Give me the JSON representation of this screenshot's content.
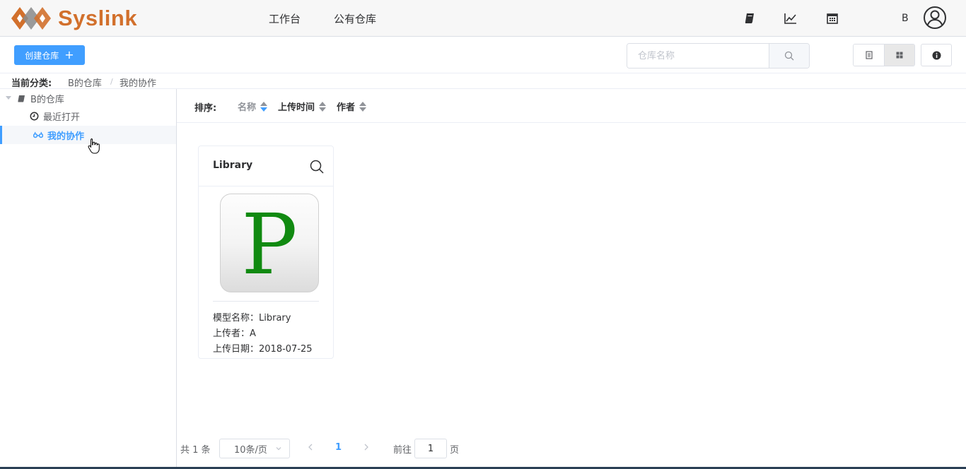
{
  "header": {
    "brand": "Syslink",
    "nav": [
      "工作台",
      "公有仓库"
    ],
    "user_initial": "B",
    "icons": [
      "book-icon",
      "line-chart-icon",
      "calendar-icon",
      "user-avatar-icon"
    ]
  },
  "toolbar": {
    "create_label": "创建仓库",
    "create_icon": "plus-icon",
    "search_placeholder": "仓库名称",
    "view_modes": [
      "list-view-icon",
      "grid-view-icon"
    ],
    "active_view": "grid",
    "info_icon": "info-icon"
  },
  "breadcrumb": {
    "label": "当前分类:",
    "items": [
      "B的仓库",
      "我的协作"
    ],
    "separator": "/"
  },
  "sidebar": {
    "root": "B的仓库",
    "items": [
      {
        "label": "最近打开",
        "icon": "clock-icon"
      },
      {
        "label": "我的协作",
        "icon": "collaboration-icon",
        "active": true
      }
    ]
  },
  "sort": {
    "label": "排序:",
    "options": [
      "名称",
      "上传时间",
      "作者"
    ]
  },
  "cards": [
    {
      "title": "Library",
      "thumb_letter": "P",
      "thumb_letter_color": "#118a11",
      "meta": [
        "模型名称：Library",
        "上传者：A",
        "上传日期：2018-07-25"
      ]
    }
  ],
  "pagination": {
    "total": "共 1 条",
    "page_size": "10条/页",
    "current": "1",
    "goto_label": "前往",
    "goto_value": "1",
    "page_suffix": "页"
  },
  "colors": {
    "primary": "#409eff",
    "brand": "#d2702c",
    "header_bg": "#f7f7f7"
  }
}
